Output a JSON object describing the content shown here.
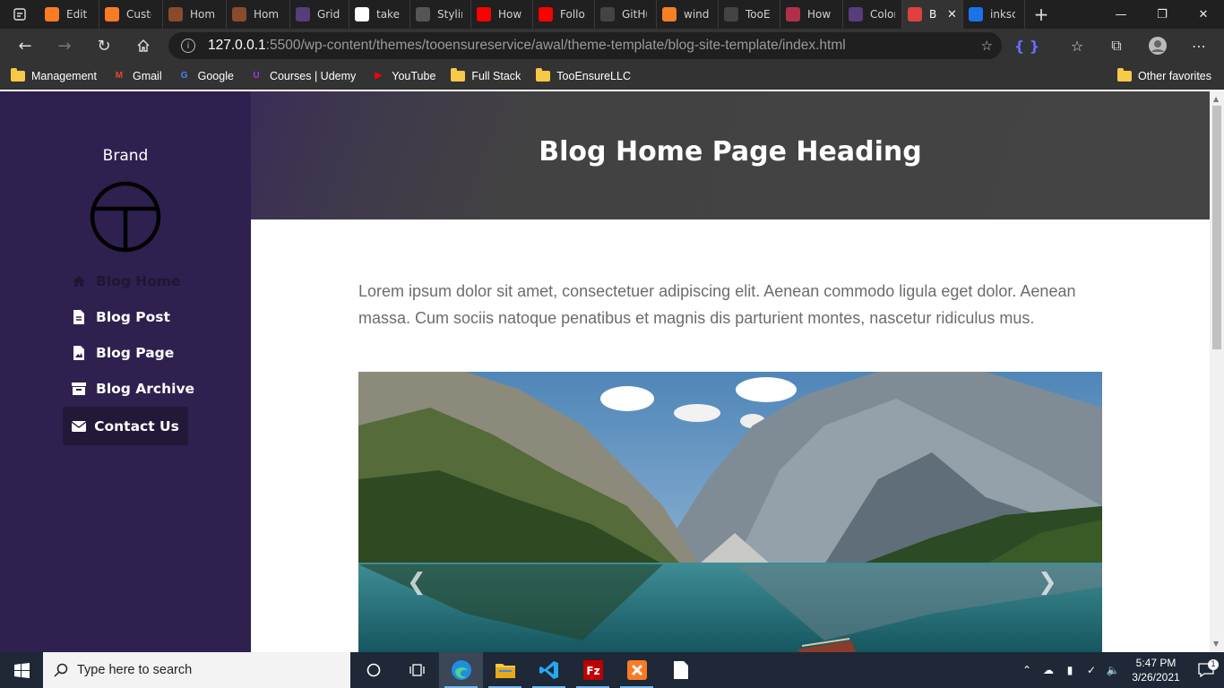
{
  "browser": {
    "tabs": [
      {
        "label": "Edit P",
        "icon": "xampp-icon",
        "color": "#fb7a24"
      },
      {
        "label": "Custo",
        "icon": "xampp-icon",
        "color": "#fb7a24"
      },
      {
        "label": "Home",
        "icon": "xampp-icon",
        "color": "#8a4b2a"
      },
      {
        "label": "Home",
        "icon": "xampp-icon",
        "color": "#8a4b2a"
      },
      {
        "label": "Grid s",
        "icon": "bootstrap-icon",
        "color": "#563d7c"
      },
      {
        "label": "take s",
        "icon": "google-icon",
        "color": "#ffffff"
      },
      {
        "label": "Stylin",
        "icon": "wordpress-icon",
        "color": "#555555"
      },
      {
        "label": "How t",
        "icon": "youtube-icon",
        "color": "#ff0000"
      },
      {
        "label": "Follo",
        "icon": "youtube-icon",
        "color": "#ff0000"
      },
      {
        "label": "GitHu",
        "icon": "github-icon",
        "color": "#444444"
      },
      {
        "label": "windo",
        "icon": "stackoverflow-icon",
        "color": "#f48024"
      },
      {
        "label": "TooEn",
        "icon": "github-icon",
        "color": "#444444"
      },
      {
        "label": "How t",
        "icon": "video-icon",
        "color": "#b0304a"
      },
      {
        "label": "Colors",
        "icon": "bootstrap-icon",
        "color": "#563d7c"
      },
      {
        "label": "B",
        "icon": "site-icon",
        "color": "#e04040",
        "active": true
      },
      {
        "label": "inksca",
        "icon": "bing-icon",
        "color": "#1a73e8"
      }
    ],
    "address": {
      "host": "127.0.0.1",
      "path": ":5500/wp-content/themes/tooensureservice/awal/theme-template/blog-site-template/index.html"
    },
    "bookmarks": [
      {
        "label": "Management",
        "icon": "folder-icon"
      },
      {
        "label": "Gmail",
        "icon": "gmail-icon"
      },
      {
        "label": "Google",
        "icon": "google-icon"
      },
      {
        "label": "Courses | Udemy",
        "icon": "udemy-icon"
      },
      {
        "label": "YouTube",
        "icon": "youtube-icon"
      },
      {
        "label": "Full Stack",
        "icon": "folder-icon"
      },
      {
        "label": "TooEnsureLLC",
        "icon": "folder-icon"
      }
    ],
    "other_bookmarks": "Other favorites"
  },
  "page": {
    "brand": "Brand",
    "heading": "Blog Home Page Heading",
    "nav": [
      {
        "label": "Blog Home",
        "icon": "home-icon"
      },
      {
        "label": "Blog Post",
        "icon": "file-icon"
      },
      {
        "label": "Blog Page",
        "icon": "file-image-icon"
      },
      {
        "label": "Blog Archive",
        "icon": "archive-icon"
      }
    ],
    "contact": {
      "label": "Contact Us",
      "icon": "envelope-icon"
    },
    "intro": "Lorem ipsum dolor sit amet, consectetuer adipiscing elit. Aenean commodo ligula eget dolor. Aenean massa. Cum sociis natoque penatibus et magnis dis parturient montes, nascetur ridiculus mus.",
    "colors": {
      "sidebar": "#2e2150",
      "hero": "#444444",
      "contact_bg": "#221838"
    }
  },
  "taskbar": {
    "search_placeholder": "Type here to search",
    "time": "5:47 PM",
    "date": "3/26/2021",
    "notification_count": "1"
  }
}
